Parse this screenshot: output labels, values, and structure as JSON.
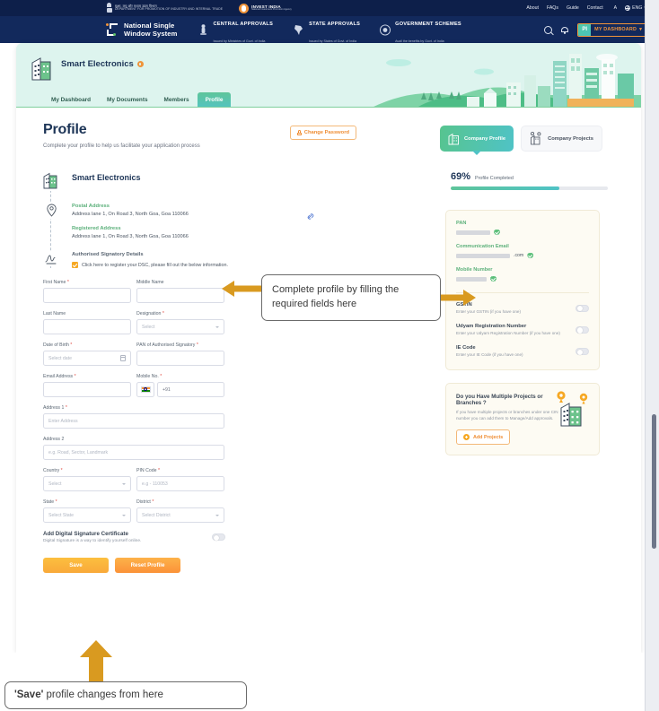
{
  "utility_bar": {
    "department_hindi": "सूक्ष्म, लघु और मध्यम उद्यम विभाग",
    "department_english": "DEPARTMENT FOR PROMOTION OF INDUSTRY AND INTERNAL TRADE",
    "invest_india": {
      "name": "INVEST INDIA",
      "subtitle": "National Investment Promotion Agency"
    },
    "links": [
      "About",
      "FAQs",
      "Guide",
      "Contact"
    ],
    "accessibility_icon": "accessibility-text-size-icon",
    "language": "ENG"
  },
  "main_nav": {
    "brand_line1": "National Single",
    "brand_line2": "Window System",
    "items": [
      {
        "title": "CENTRAL APPROVALS",
        "subtitle": "Issued by Ministries of Govt. of India",
        "icon": "emblem-icon"
      },
      {
        "title": "STATE APPROVALS",
        "subtitle": "Issued by States of Govt. of India",
        "icon": "india-map-icon"
      },
      {
        "title": "GOVERNMENT SCHEMES",
        "subtitle": "Avail the benefits by Govt. of India",
        "icon": "seal-icon"
      }
    ],
    "search_icon": "search-icon",
    "bell_icon": "notification-bell-icon",
    "avatar_initials": "PI",
    "dashboard_label": "MY DASHBOARD"
  },
  "banner": {
    "company_name": "Smart Electronics",
    "edit_icon": "edit-company-icon",
    "building_icon": "building-icon",
    "tabs": [
      {
        "label": "My Dashboard",
        "active": false
      },
      {
        "label": "My Documents",
        "active": false
      },
      {
        "label": "Members",
        "active": false
      },
      {
        "label": "Profile",
        "active": true
      }
    ]
  },
  "profile": {
    "title": "Profile",
    "subtitle": "Complete your profile to help us facilitate your application process",
    "change_password_label": "Change Password",
    "company_name": "Smart Electronics",
    "postal_address_label": "Postal Address",
    "postal_address_value": "Address lane 1, On Road 3, North Goa, Goa 110066",
    "registered_address_label": "Registered Address",
    "registered_address_value": "Address lane 1, On Road 3, North Goa, Goa 110066",
    "signatory_label": "Authorised Signatory Details",
    "dsc_checkbox_text": "Click here to register your DSC, please fill out the below information."
  },
  "form": {
    "rows": [
      [
        {
          "label": "First Name",
          "required": true,
          "value": "",
          "placeholder": "",
          "type": "text",
          "name": "first-name-input"
        },
        {
          "label": "Middle Name",
          "required": false,
          "value": "",
          "placeholder": "",
          "type": "text",
          "name": "middle-name-input"
        }
      ],
      [
        {
          "label": "Last Name",
          "required": false,
          "value": "",
          "placeholder": "",
          "type": "text",
          "name": "last-name-input"
        },
        {
          "label": "Designation",
          "required": true,
          "value": "",
          "placeholder": "Select",
          "type": "select",
          "name": "designation-select"
        }
      ],
      [
        {
          "label": "Date of Birth",
          "required": true,
          "value": "",
          "placeholder": "Select date",
          "type": "date",
          "name": "date-of-birth-input"
        },
        {
          "label": "PAN of Authorised Signatory",
          "required": true,
          "value": "",
          "placeholder": "",
          "type": "text",
          "name": "pan-signatory-input"
        }
      ],
      [
        {
          "label": "Email Address",
          "required": true,
          "value": "",
          "placeholder": "",
          "type": "text",
          "name": "email-address-input"
        },
        {
          "label": "Mobile No.",
          "required": true,
          "value": "+91",
          "placeholder": "",
          "type": "phone",
          "name": "mobile-number-input"
        }
      ]
    ],
    "address1": {
      "label": "Address 1",
      "required": true,
      "placeholder": "Enter Address",
      "name": "address-line-1-input"
    },
    "address2": {
      "label": "Address 2",
      "required": false,
      "placeholder": "e.g. Road, Sector, Landmark",
      "name": "address-line-2-input"
    },
    "rows2": [
      [
        {
          "label": "Country",
          "required": true,
          "value": "",
          "placeholder": "Select",
          "type": "select",
          "name": "country-select"
        },
        {
          "label": "PIN Code",
          "required": true,
          "value": "",
          "placeholder": "e.g - 110053",
          "type": "text",
          "name": "pin-code-input"
        }
      ],
      [
        {
          "label": "State",
          "required": true,
          "value": "",
          "placeholder": "Select State",
          "type": "select",
          "name": "state-select"
        },
        {
          "label": "District",
          "required": true,
          "value": "",
          "placeholder": "Select District",
          "type": "select",
          "name": "district-select"
        }
      ]
    ],
    "dsc_toggle": {
      "title": "Add Digital Signature Certificate",
      "subtitle": "Digital Signature is a way to identify yourself online.",
      "enabled": false
    },
    "save_label": "Save",
    "reset_label": "Reset Profile"
  },
  "sidebar": {
    "segments": [
      {
        "label": "Company Profile",
        "active": true,
        "icon": "building-icon"
      },
      {
        "label": "Company Projects",
        "active": false,
        "icon": "buildings-pin-icon"
      }
    ],
    "progress": {
      "percent": "69%",
      "label": "Profile Completed",
      "value": 69
    },
    "kyc": [
      {
        "label": "PAN",
        "value": "",
        "redacted": true,
        "verified": true,
        "name": "pan-value"
      },
      {
        "label": "Communication Email",
        "value": ".com",
        "redacted": true,
        "verified": true,
        "name": "communication-email-value"
      },
      {
        "label": "Mobile Number",
        "value": "",
        "redacted": true,
        "verified": true,
        "name": "mobile-number-value"
      }
    ],
    "options": [
      {
        "title": "GSTIN",
        "subtitle": "Enter your GSTIN (if you have one)",
        "enabled": false,
        "name": "gstin-toggle"
      },
      {
        "title": "Udyam Registration Number",
        "subtitle": "Enter your Udyam Registration Number (if you have one)",
        "enabled": false,
        "name": "udyam-toggle"
      },
      {
        "title": "IE Code",
        "subtitle": "Enter your IE Code (if you have one)",
        "enabled": false,
        "name": "ie-code-toggle"
      }
    ],
    "projects_card": {
      "title": "Do you Have Multiple Projects or Branches ?",
      "subtitle": "If you have multiple projects or branches under one CIN number you can add them to Manage/Add approvals.",
      "button_label": "Add Projects"
    }
  },
  "annotations": {
    "fields_callout": "Complete profile by filling the required fields here",
    "save_callout_quoted": "'Save'",
    "save_callout_rest": " profile changes from here",
    "arrow_color": "#d99a20"
  }
}
